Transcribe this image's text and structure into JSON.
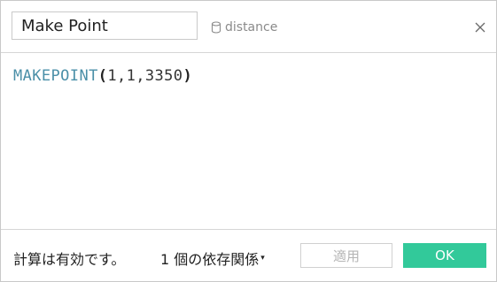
{
  "header": {
    "calc_name": "Make Point",
    "datasource_label": "distance",
    "datasource_icon": "database-icon",
    "close_icon": "close-icon"
  },
  "editor": {
    "function_name": "MAKEPOINT",
    "open_paren": "(",
    "arguments": "1,1,3350",
    "close_paren": ")"
  },
  "footer": {
    "status_text": "計算は有効です。",
    "dependencies_label": "1 個の依存関係",
    "dependencies_caret": "▾",
    "apply_label": "適用",
    "ok_label": "OK"
  },
  "colors": {
    "function_blue": "#4a8fa8",
    "ok_green": "#32c99a",
    "muted_gray": "#8a8a8a"
  }
}
